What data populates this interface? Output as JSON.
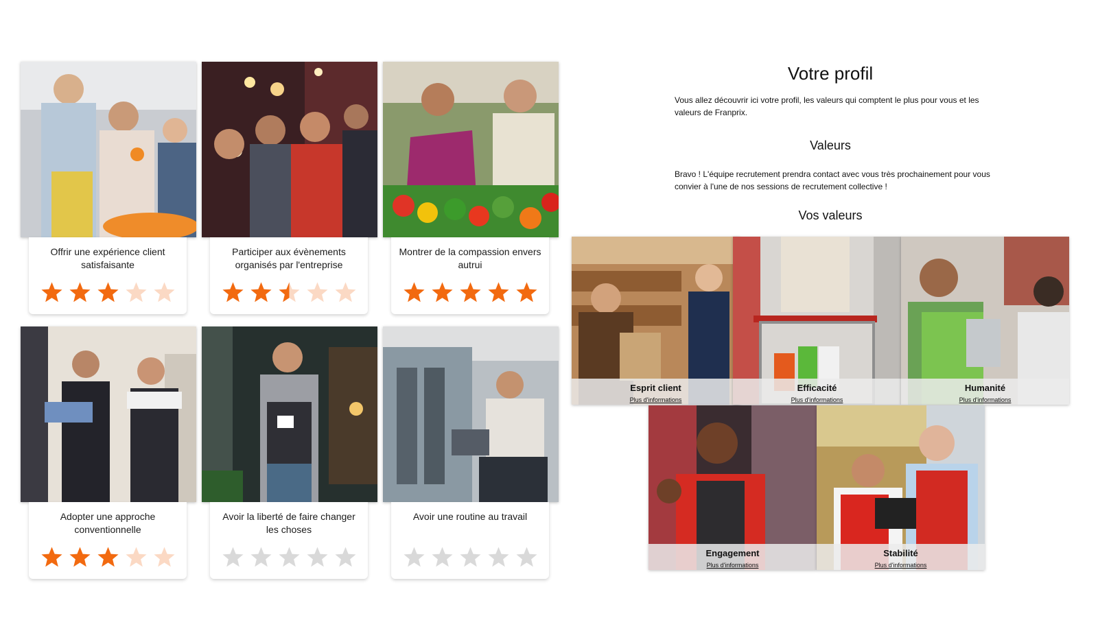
{
  "cards": [
    {
      "label": "Offrir une expérience client satisfaisante",
      "rating": 3
    },
    {
      "label": "Participer aux évènements organisés par l'entreprise",
      "rating": 2.5
    },
    {
      "label": "Montrer de la compassion envers autrui",
      "rating": 5
    },
    {
      "label": "Adopter une approche conventionnelle",
      "rating": 3
    },
    {
      "label": "Avoir la liberté de faire changer les choses",
      "rating": 0
    },
    {
      "label": "Avoir une routine au travail",
      "rating": 0
    }
  ],
  "profile": {
    "title": "Votre profil",
    "intro": "Vous allez découvrir ici votre profil, les valeurs qui comptent le plus pour vous et les valeurs de Franprix.",
    "valeurs_heading": "Valeurs",
    "message": "Bravo ! L'équipe recrutement prendra contact avec vous très prochainement pour vous convier à l'une de nos sessions de recrutement collective !",
    "vos_valeurs_heading": "Vos valeurs"
  },
  "values": [
    {
      "name": "Esprit client",
      "link": "Plus d'informations"
    },
    {
      "name": "Efficacité",
      "link": "Plus d'informations"
    },
    {
      "name": "Humanité",
      "link": "Plus d'informations"
    },
    {
      "name": "Engagement",
      "link": "Plus d'informations"
    },
    {
      "name": "Stabilité",
      "link": "Plus d'informations"
    }
  ],
  "colors": {
    "star_active": "#f26a10",
    "star_faded": "#fbd9c4",
    "star_empty": "#d9d9d9"
  }
}
